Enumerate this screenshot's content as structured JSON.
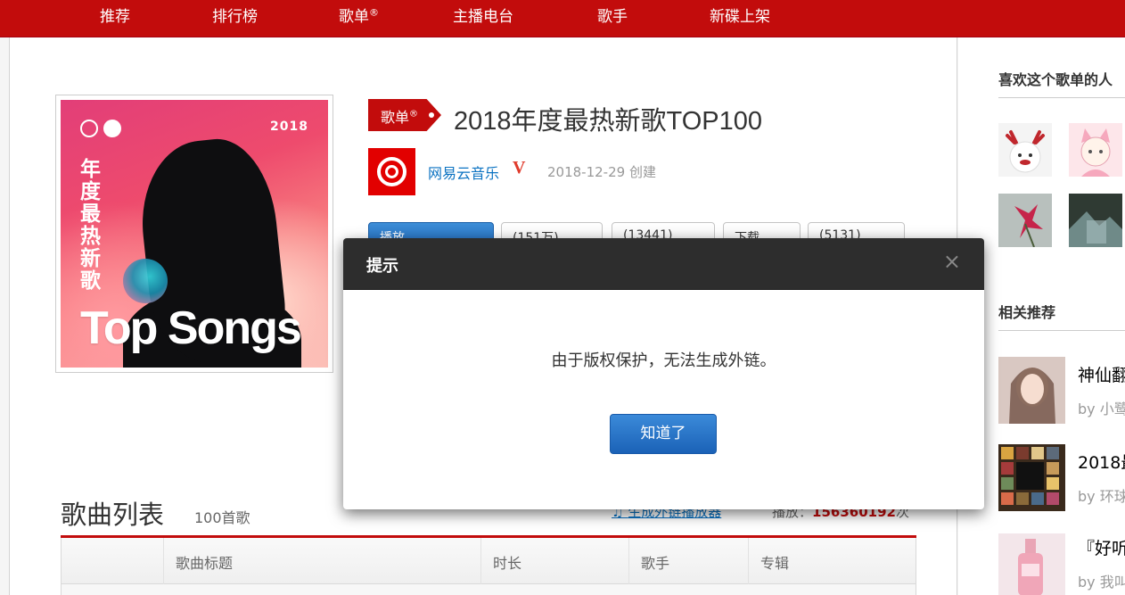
{
  "nav": {
    "items": [
      "推荐",
      "排行榜",
      "歌单",
      "主播电台",
      "歌手",
      "新碟上架"
    ],
    "registered_mark": "®"
  },
  "playlist": {
    "cover": {
      "title_vertical": "年度最热新歌",
      "year": "2018",
      "headline": "Top Songs"
    },
    "tag_label": "歌单",
    "tag_mark": "®",
    "title": "2018年度最热新歌TOP100",
    "creator": "网易云音乐",
    "verified_mark": "V",
    "created": "2018-12-29 创建",
    "buttons": {
      "play": "播放",
      "add": "+",
      "collect": "(151万)",
      "share": "(13441)",
      "download": "下载",
      "comment": "(5131)"
    }
  },
  "song_list": {
    "title": "歌曲列表",
    "count": "100首歌",
    "external_player": "生成外链播放器",
    "play_label": "播放：",
    "play_count": "156360192",
    "play_unit": "次",
    "columns": [
      "",
      "歌曲标题",
      "时长",
      "歌手",
      "专辑"
    ]
  },
  "sidebar": {
    "likers_heading": "喜欢这个歌单的人",
    "related_heading": "相关推荐",
    "related": [
      {
        "title": "神仙翻",
        "by": "by 小鹭"
      },
      {
        "title": "2018最",
        "by": "by 环球"
      },
      {
        "title": "『好听",
        "by": "by 我叫"
      }
    ]
  },
  "dialog": {
    "title": "提示",
    "close": "×",
    "message": "由于版权保护，无法生成外链。",
    "ok_label": "知道了"
  },
  "colors": {
    "brand_red": "#c20c0c",
    "link_blue": "#0c73c2",
    "button_blue": "#2a76c6"
  }
}
